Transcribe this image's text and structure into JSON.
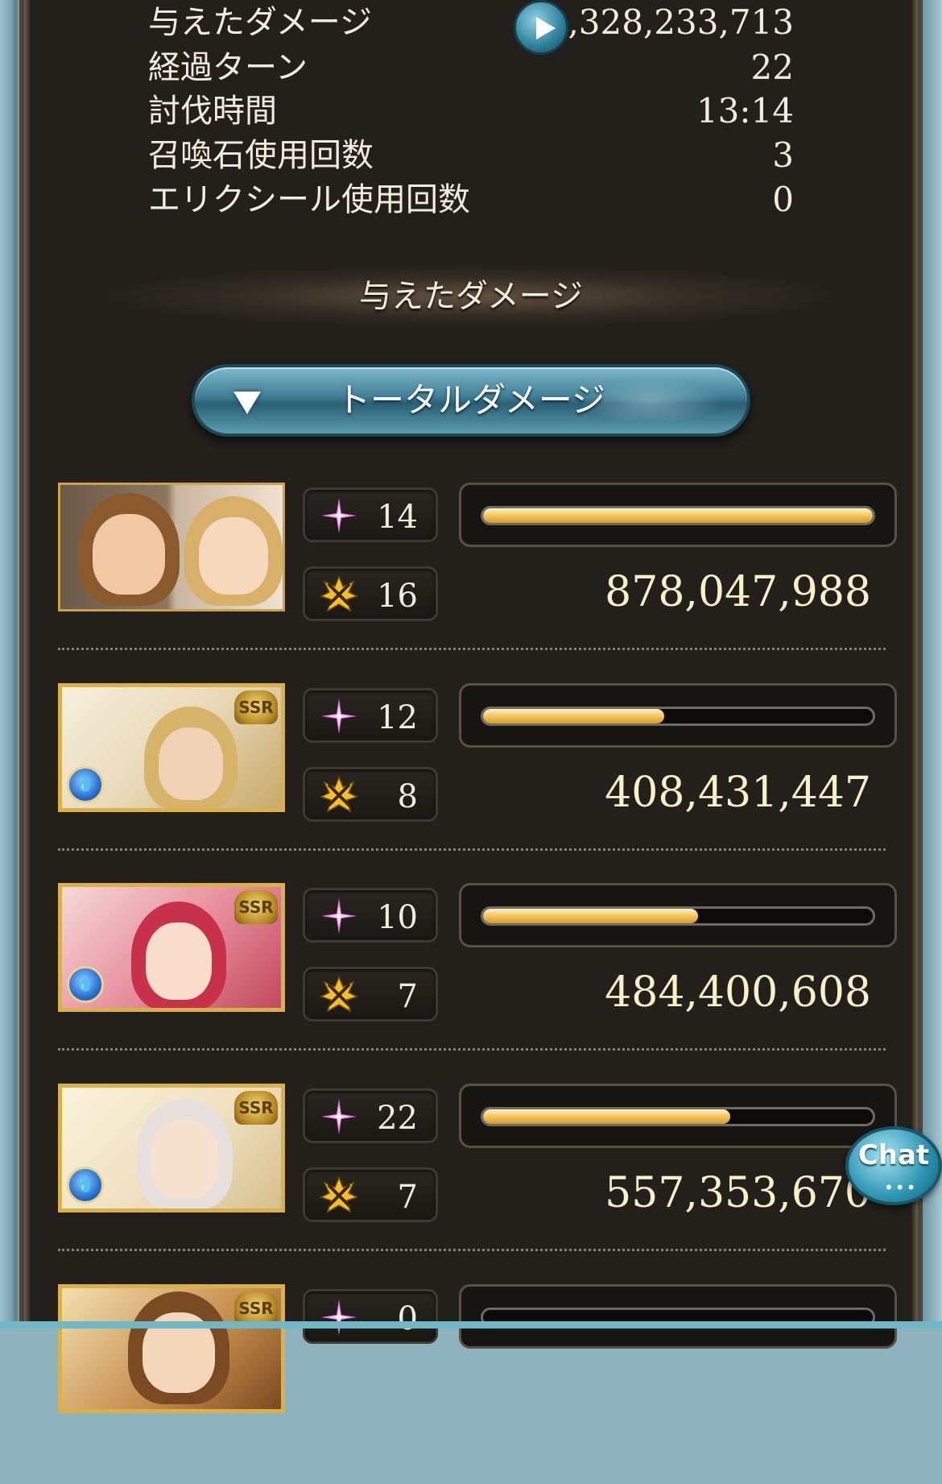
{
  "summary": {
    "damage_label": "与えたダメージ",
    "damage_value": "2,328,233,713",
    "turns_label": "経過ターン",
    "turns_value": "22",
    "time_label": "討伐時間",
    "time_value": "13:14",
    "summon_label": "召喚石使用回数",
    "summon_value": "3",
    "elixir_label": "エリクシール使用回数",
    "elixir_value": "0"
  },
  "section": {
    "heading": "与えたダメージ"
  },
  "dropdown": {
    "label": "トータルダメージ",
    "icon": "chevron-down-icon"
  },
  "characters": [
    {
      "portrait": "main-character-pair",
      "ssr": false,
      "element": null,
      "skills": "14",
      "ougi": "16",
      "bar_fraction": 1.0,
      "damage": "878,047,988"
    },
    {
      "portrait": "blonde-man-character",
      "ssr": true,
      "ssr_label": "SSR",
      "element": "water",
      "element_icon": "water-element-icon",
      "skills": "12",
      "ougi": "8",
      "bar_fraction": 0.465,
      "damage": "408,431,447"
    },
    {
      "portrait": "red-hair-character",
      "ssr": true,
      "ssr_label": "SSR",
      "element": "water",
      "element_icon": "water-element-icon",
      "skills": "10",
      "ougi": "7",
      "bar_fraction": 0.552,
      "damage": "484,400,608"
    },
    {
      "portrait": "silver-hair-character",
      "ssr": true,
      "ssr_label": "SSR",
      "element": "water",
      "element_icon": "water-element-icon",
      "skills": "22",
      "ougi": "7",
      "bar_fraction": 0.635,
      "damage": "557,353,670"
    },
    {
      "portrait": "brown-hair-character",
      "ssr": true,
      "ssr_label": "SSR",
      "element": null,
      "skills": "0",
      "ougi": "",
      "bar_fraction": 0,
      "damage": ""
    }
  ],
  "icons": {
    "skill": "sparkle-icon",
    "ougi": "crossed-swords-icon",
    "play": "play-icon"
  },
  "chat": {
    "label": "Chat",
    "dots": "•••"
  },
  "colors": {
    "panel_bg": "#23201b",
    "bar_fill": "#f2c65e",
    "damage_text": "#f7f0c8",
    "accent_blue": "#3e7d94",
    "skill_pink": "#e36bd6",
    "ougi_gold": "#f3c02c"
  }
}
